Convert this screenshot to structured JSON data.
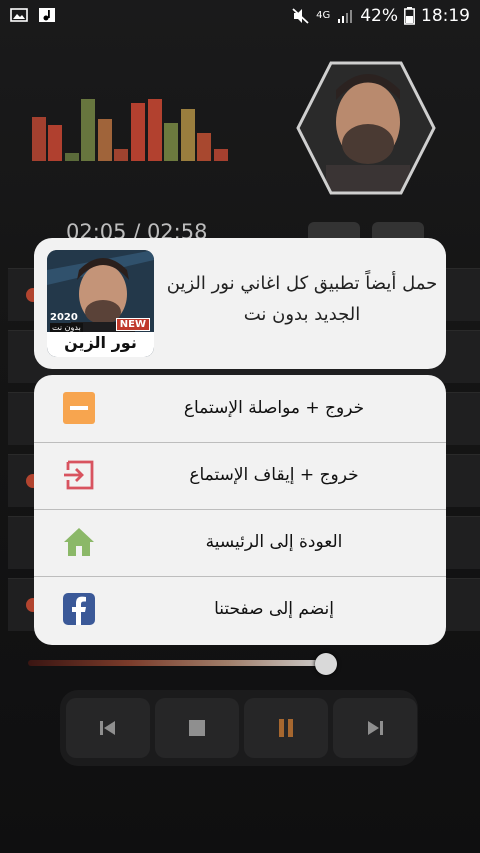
{
  "status_bar": {
    "network": "4G",
    "battery": "42%",
    "time": "18:19"
  },
  "player": {
    "time": "02:05 / 02:58"
  },
  "promo": {
    "thumb_badge_year": "2020",
    "thumb_badge_sub": "بدون نت",
    "thumb_badge_new": "NEW",
    "thumb_title": "نور الزين",
    "text": "حمل أيضاً تطبيق كل اغاني نور الزين الجديد بدون نت"
  },
  "menu": {
    "items": [
      {
        "label": "خروج + مواصلة الإستماع",
        "icon": "minus-icon"
      },
      {
        "label": "خروج + إيقاف الإستماع",
        "icon": "exit-icon"
      },
      {
        "label": "العودة إلى الرئيسية",
        "icon": "home-icon"
      },
      {
        "label": "إنضم إلى صفحتنا",
        "icon": "facebook-icon"
      }
    ]
  },
  "colors": {
    "accent_orange": "#f7a54f",
    "exit_red": "#d8535f",
    "home_green": "#8bb868",
    "facebook_blue": "#3b5998"
  }
}
